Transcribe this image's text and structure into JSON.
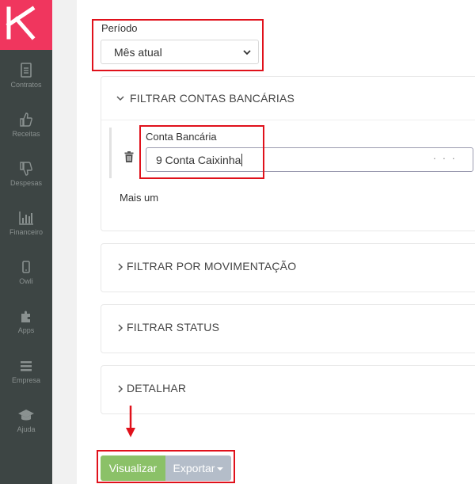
{
  "sidebar": {
    "items": [
      {
        "label": "Contratos",
        "icon": "document-icon"
      },
      {
        "label": "Receitas",
        "icon": "thumbs-up-icon"
      },
      {
        "label": "Despesas",
        "icon": "thumbs-down-icon"
      },
      {
        "label": "Financeiro",
        "icon": "bar-chart-icon"
      },
      {
        "label": "Owli",
        "icon": "mobile-icon"
      },
      {
        "label": "Apps",
        "icon": "puzzle-icon"
      },
      {
        "label": "Empresa",
        "icon": "menu-icon"
      },
      {
        "label": "Ajuda",
        "icon": "graduation-cap-icon"
      }
    ]
  },
  "periodo": {
    "label": "Período",
    "value": "Mês atual"
  },
  "filters": {
    "contas": {
      "title": "FILTRAR CONTAS BANCÁRIAS",
      "field_label": "Conta Bancária",
      "field_value": "9 Conta Caixinha",
      "more_label": "· · ·",
      "add_label": "Mais um"
    },
    "movimentacao": {
      "title": "FILTRAR POR MOVIMENTAÇÃO"
    },
    "status": {
      "title": "FILTRAR STATUS"
    },
    "detalhar": {
      "title": "DETALHAR"
    }
  },
  "actions": {
    "visualizar": "Visualizar",
    "exportar": "Exportar"
  },
  "colors": {
    "brand": "#f0365e",
    "sidebar": "#3d4544",
    "primary_button": "#8bc168",
    "secondary_button": "#b4bdc9",
    "annotation": "#e0111b"
  }
}
